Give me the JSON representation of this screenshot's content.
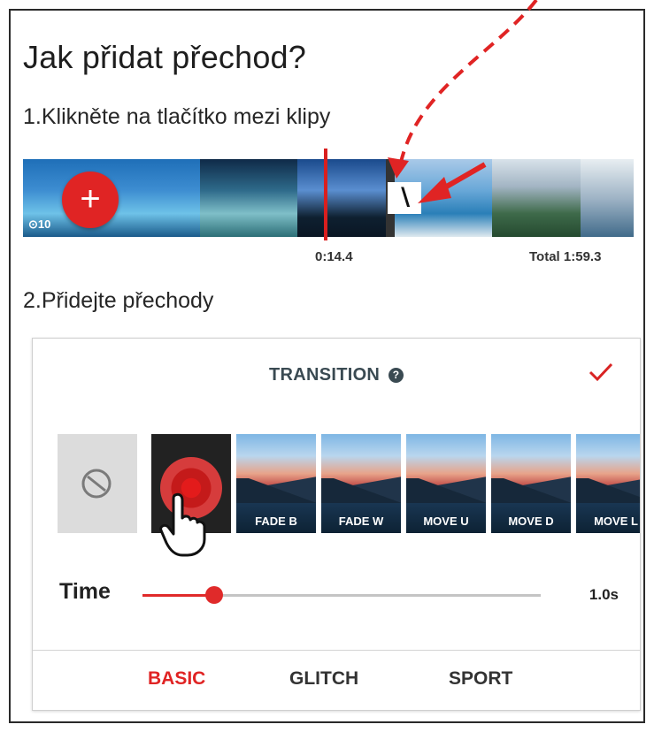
{
  "heading": "Jak přidat přechod?",
  "steps": {
    "step1": "1.Klikněte na tlačítko mezi klipy",
    "step2": "2.Přidejte přechody"
  },
  "timeline": {
    "add_label": "+",
    "clip_duration": "⊙10",
    "current_time": "0:14.4",
    "total_time": "Total 1:59.3",
    "transition_slot_icon": "transition-slot-icon"
  },
  "panel": {
    "title": "TRANSITION",
    "help_icon": "?",
    "confirm_icon": "check-icon",
    "effects": [
      {
        "label": "",
        "icon": "none-icon"
      },
      {
        "label": "",
        "selected": true
      },
      {
        "label": "FADE B"
      },
      {
        "label": "FADE W"
      },
      {
        "label": "MOVE U"
      },
      {
        "label": "MOVE D"
      },
      {
        "label": "MOVE L"
      }
    ],
    "time_label": "Time",
    "time_value": "1.0s",
    "slider_fraction": 0.18,
    "tabs": [
      "BASIC",
      "GLITCH",
      "SPORT"
    ],
    "active_tab": "BASIC"
  },
  "colors": {
    "accent": "#e02424",
    "panel_title": "#3a4a52"
  }
}
